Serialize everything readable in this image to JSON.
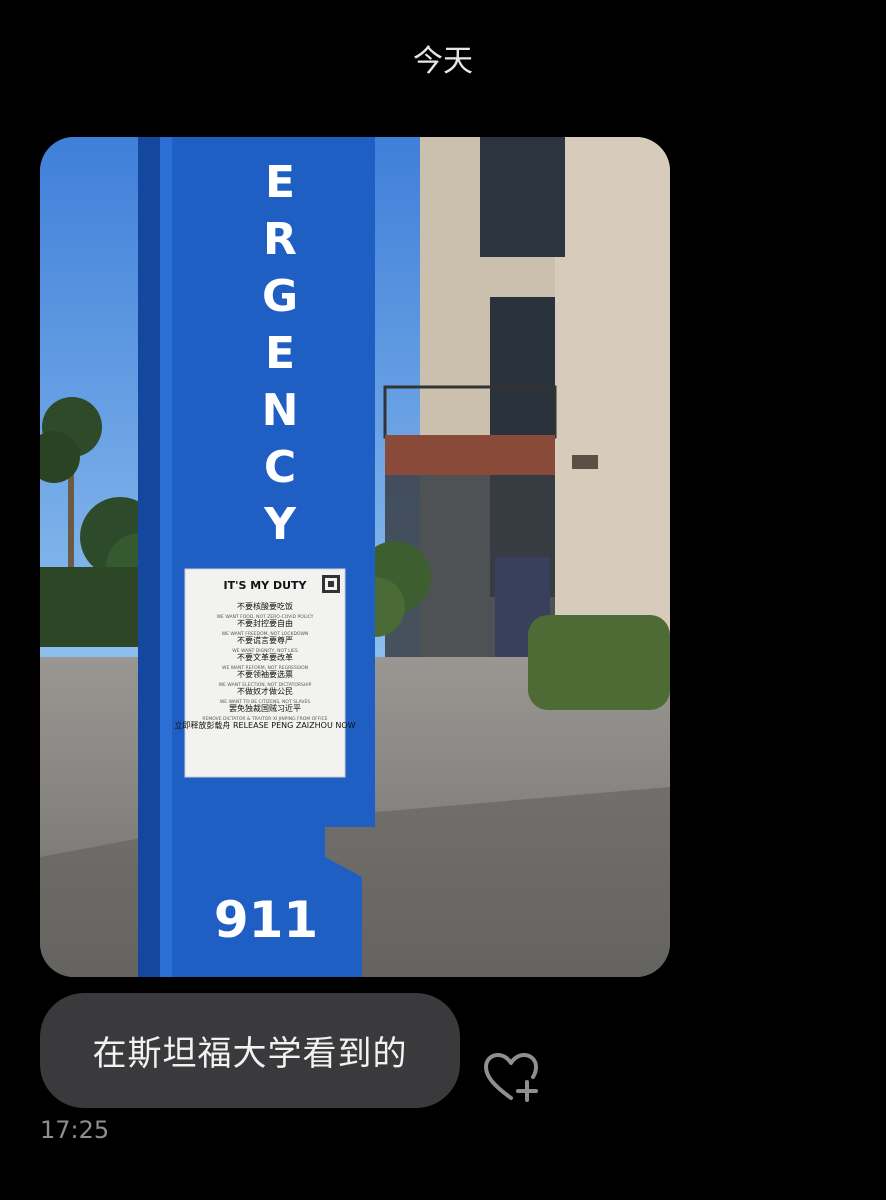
{
  "chat": {
    "date_header": "今天",
    "message_text": "在斯坦福大学看到的",
    "timestamp": "17:25"
  },
  "photo": {
    "pillar_text": "ERGENCY",
    "pillar_number": "911",
    "poster": {
      "title": "IT'S MY DUTY",
      "lines": [
        "不要核酸要吃饭",
        "WE WANT FOOD, NOT ZERO-COVID POLICY",
        "不要封控要自由",
        "WE WANT FREEDOM, NOT LOCKDOWN",
        "不要谎言要尊严",
        "WE WANT DIGNITY, NOT LIES",
        "不要文革要改革",
        "WE WANT REFORM, NOT REGRESSION",
        "不要领袖要选票",
        "WE WANT ELECTION, NOT DICTATORSHIP",
        "不做奴才做公民",
        "WE WANT TO BE CITIZENS, NOT SLAVES",
        "罢免独裁国贼习近平",
        "REMOVE DICTATOR & TRAITOR XI JINPING FROM OFFICE",
        "立即释放彭载舟 RELEASE PENG ZAIZHOU NOW"
      ]
    }
  },
  "icons": {
    "react": "heart-plus-icon"
  },
  "colors": {
    "background": "#000000",
    "bubble": "#3a3a3c",
    "pillar_blue": "#1f5fc4",
    "sky": "#4a86d8"
  }
}
